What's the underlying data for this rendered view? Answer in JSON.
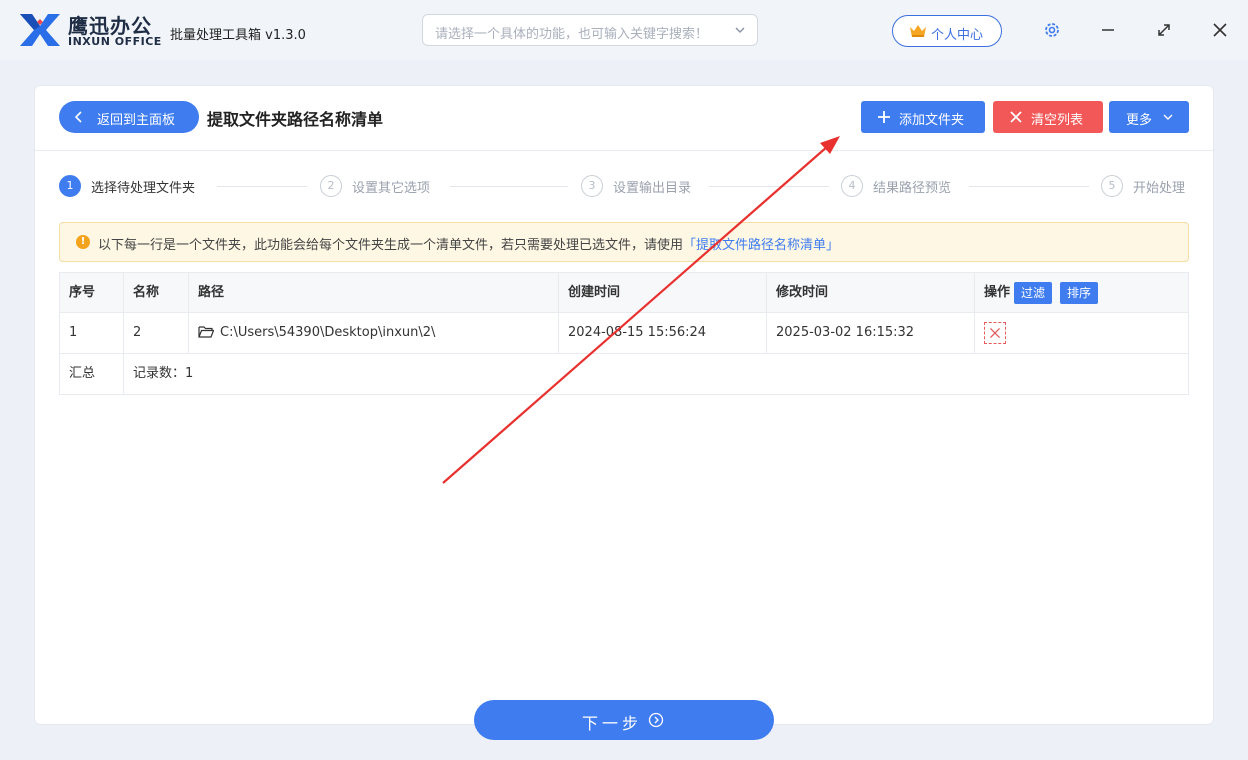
{
  "app": {
    "brand_cn": "鹰迅办公",
    "brand_en": "INXUN OFFICE",
    "title": "批量处理工具箱 v1.3.0",
    "search_placeholder": "请选择一个具体的功能，也可输入关键字搜索！",
    "user_center": "个人中心"
  },
  "toolbar": {
    "back_label": "返回到主面板",
    "page_title": "提取文件夹路径名称清单",
    "add_folder": "添加文件夹",
    "clear_list": "清空列表",
    "more": "更多"
  },
  "steps": [
    {
      "num": "1",
      "label": "选择待处理文件夹"
    },
    {
      "num": "2",
      "label": "设置其它选项"
    },
    {
      "num": "3",
      "label": "设置输出目录"
    },
    {
      "num": "4",
      "label": "结果路径预览"
    },
    {
      "num": "5",
      "label": "开始处理"
    }
  ],
  "notice": {
    "text": "以下每一行是一个文件夹，此功能会给每个文件夹生成一个清单文件，若只需要处理已选文件，请使用",
    "link": "「提取文件路径名称清单」"
  },
  "table": {
    "headers": {
      "index": "序号",
      "name": "名称",
      "path": "路径",
      "created": "创建时间",
      "modified": "修改时间",
      "actions": "操作",
      "filter": "过滤",
      "sort": "排序"
    },
    "rows": [
      {
        "index": "1",
        "name": "2",
        "path": "C:\\Users\\54390\\Desktop\\inxun\\2\\",
        "created": "2024-08-15 15:56:24",
        "modified": "2025-03-02 16:15:32"
      }
    ],
    "summary_label": "汇总",
    "summary_count_label": "记录数：",
    "summary_count": "1"
  },
  "footer": {
    "next": "下一步"
  },
  "colors": {
    "primary": "#3f7cf0",
    "danger": "#f15857",
    "annotation_arrow": "#e8312f"
  }
}
